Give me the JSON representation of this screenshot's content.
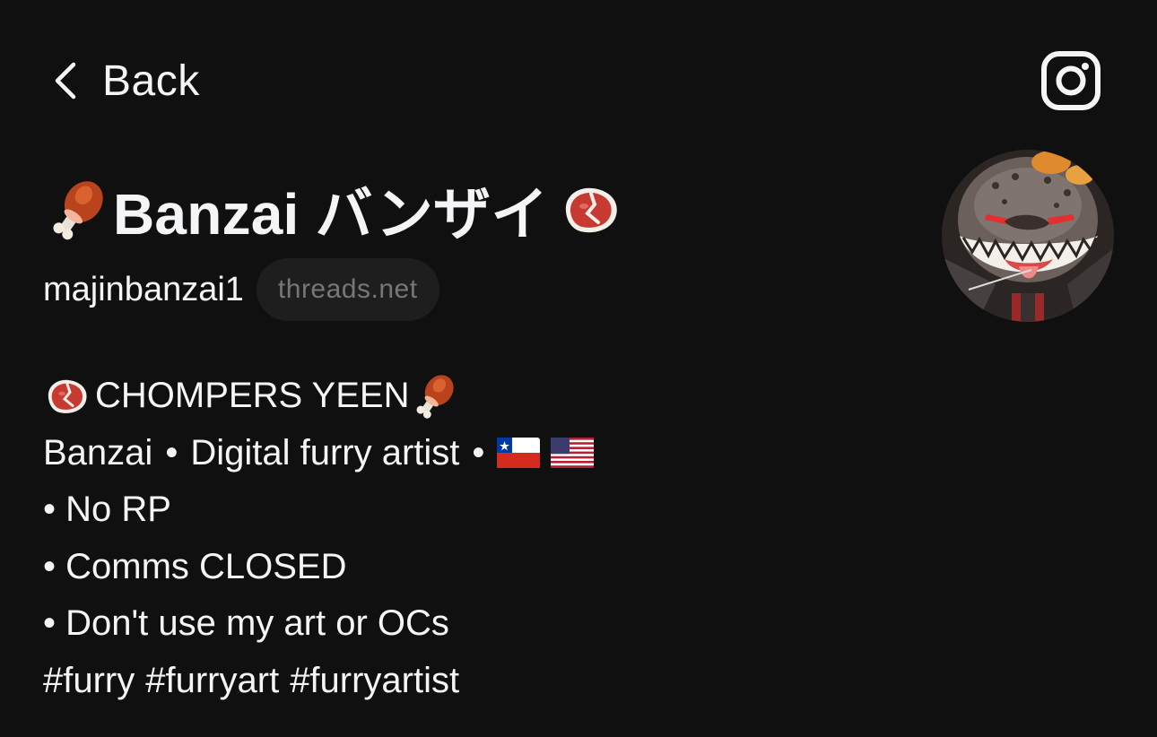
{
  "header": {
    "back_label": "Back",
    "back_icon": "chevron-left-icon",
    "instagram_icon": "instagram-icon"
  },
  "profile": {
    "display_name": "Banzai バンザイ",
    "username": "majinbanzai1",
    "domain_badge": "threads.net",
    "name_emoji_left": "meat-on-bone-icon",
    "name_emoji_right": "steak-icon",
    "avatar": "hyena-character-avatar"
  },
  "bio": {
    "line1": "CHOMPERS YEEN",
    "line2_a": "Banzai",
    "line2_b": "Digital furry artist",
    "separator": "•",
    "flags": [
      "chile-flag-icon",
      "usa-flag-icon"
    ],
    "line3": "• No RP",
    "line4": "• Comms CLOSED",
    "line5": "• Don't use my art or OCs",
    "hashtags": [
      "#furry",
      "#furryart",
      "#furryartist"
    ]
  },
  "colors": {
    "background": "#101010",
    "text": "#f3f5f7",
    "secondary_text": "#777777",
    "pill_background": "#1e1e1e"
  }
}
